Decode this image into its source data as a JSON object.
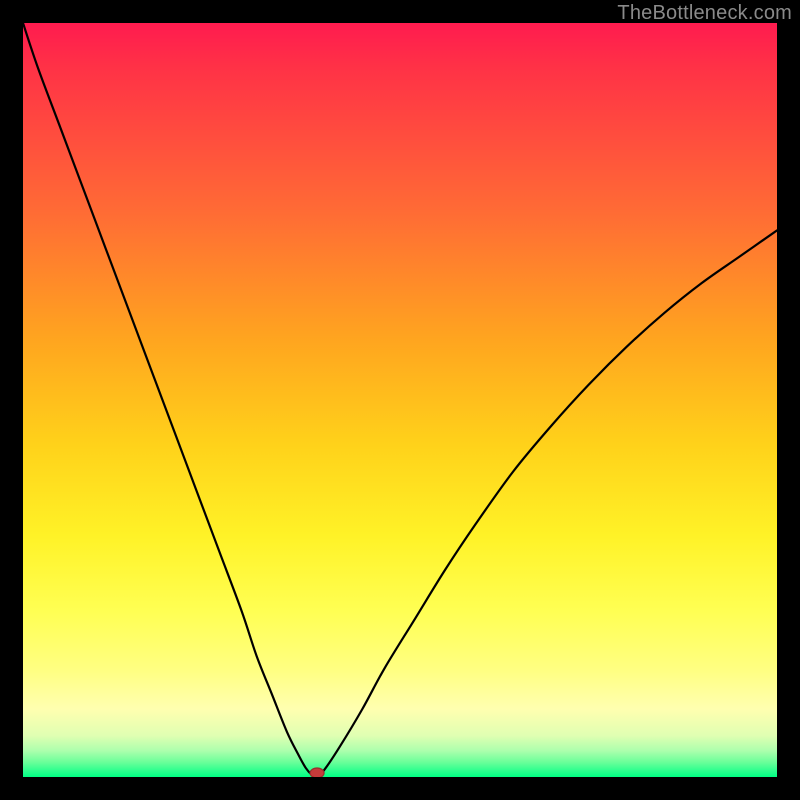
{
  "watermark": "TheBottleneck.com",
  "chart_data": {
    "type": "line",
    "title": "",
    "xlabel": "",
    "ylabel": "",
    "xlim": [
      0,
      100
    ],
    "ylim": [
      0,
      100
    ],
    "grid": false,
    "legend": false,
    "background": "rainbow-gradient",
    "series": [
      {
        "name": "bottleneck-curve",
        "x": [
          0,
          2,
          5,
          8,
          11,
          14,
          17,
          20,
          23,
          26,
          29,
          31,
          33,
          35,
          36.5,
          37.5,
          38.3,
          39,
          40,
          42,
          45,
          48,
          52,
          56,
          60,
          65,
          70,
          75,
          80,
          85,
          90,
          95,
          100
        ],
        "values": [
          100,
          94,
          86,
          78,
          70,
          62,
          54,
          46,
          38,
          30,
          22,
          16,
          11,
          6,
          3,
          1.2,
          0.3,
          0,
          1,
          4,
          9,
          14.5,
          21,
          27.5,
          33.5,
          40.5,
          46.5,
          52,
          57,
          61.5,
          65.5,
          69,
          72.5
        ]
      }
    ],
    "min_marker": {
      "x": 39,
      "y": 0
    }
  }
}
